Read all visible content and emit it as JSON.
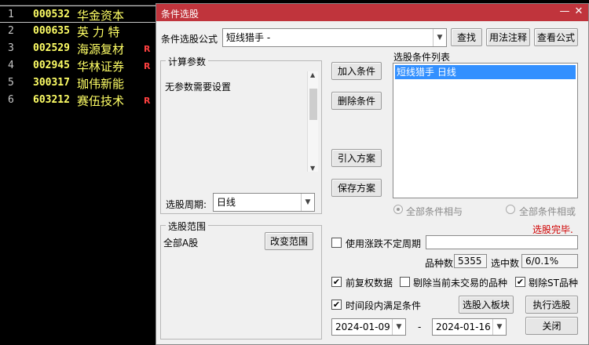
{
  "stocks": [
    {
      "idx": "1",
      "code": "000532",
      "name": "华金资本",
      "flag": ""
    },
    {
      "idx": "2",
      "code": "000635",
      "name": "英 力 特",
      "flag": ""
    },
    {
      "idx": "3",
      "code": "002529",
      "name": "海源复材",
      "flag": "R"
    },
    {
      "idx": "4",
      "code": "002945",
      "name": "华林证券",
      "flag": "R"
    },
    {
      "idx": "5",
      "code": "300317",
      "name": "珈伟新能",
      "flag": ""
    },
    {
      "idx": "6",
      "code": "603212",
      "name": "赛伍技术",
      "flag": "R"
    }
  ],
  "dialog": {
    "title": "条件选股",
    "formula_label": "条件选股公式",
    "formula_value": "短线猎手      -",
    "find_button": "查找",
    "usage_button": "用法注释",
    "view_formula_button": "查看公式",
    "params_group": "计算参数",
    "params_text": "无参数需要设置",
    "period_label": "选股周期:",
    "period_value": "日线",
    "add_condition": "加入条件",
    "delete_condition": "删除条件",
    "import_plan": "引入方案",
    "save_plan": "保存方案",
    "list_label": "选股条件列表",
    "list_items": [
      "短线猎手  日线"
    ],
    "radio_and": "全部条件相与",
    "radio_or": "全部条件相或",
    "status": "选股完毕.",
    "range_group": "选股范围",
    "range_value": "全部A股",
    "change_range": "改变范围",
    "use_period_label": "使用涨跌不定周期",
    "count_label": "品种数",
    "count_value": "5355",
    "selected_label": "选中数",
    "selected_value": "6/0.1%",
    "pre_adjust_label": "前复权数据",
    "exclude_untraded_label": "剔除当前未交易的品种",
    "exclude_st_label": "剔除ST品种",
    "time_range_label": "时间段内满足条件",
    "to_block_button": "选股入板块",
    "execute_button": "执行选股",
    "date_from": "2024-01-09",
    "date_sep": "-",
    "date_to": "2024-01-16",
    "close_button": "关闭",
    "status_color": "#d00000",
    "title_color": "#c0343c"
  }
}
